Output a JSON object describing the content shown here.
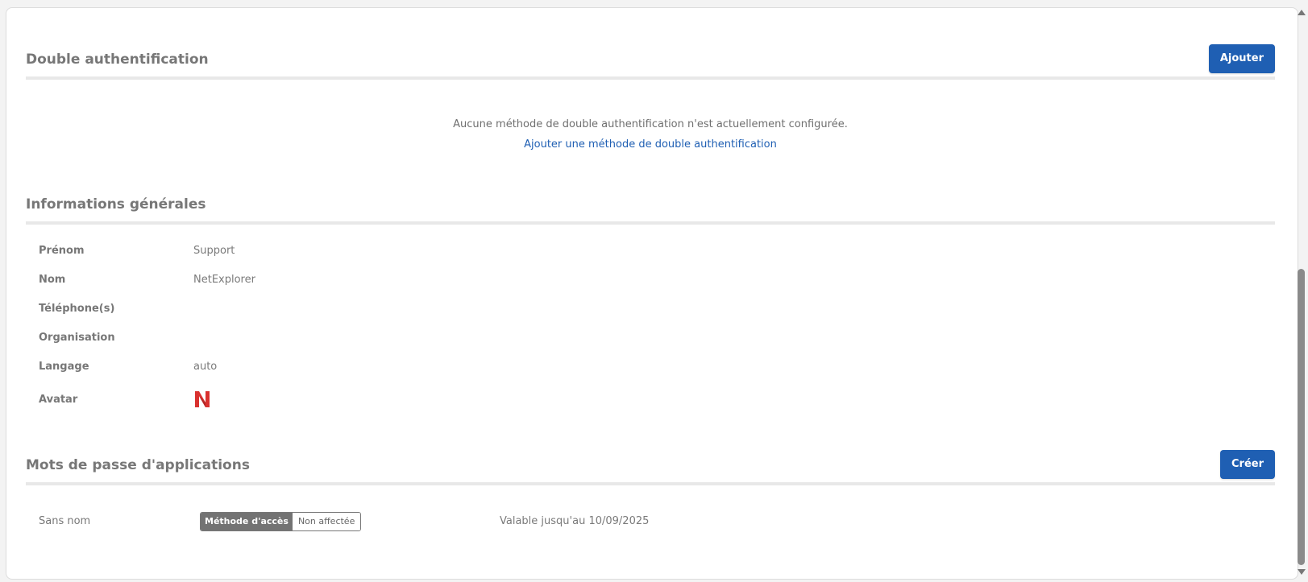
{
  "two_factor": {
    "title": "Double authentification",
    "add_button": "Ajouter",
    "empty_message": "Aucune méthode de double authentification n'est actuellement configurée.",
    "add_link": "Ajouter une méthode de double authentification"
  },
  "general_info": {
    "title": "Informations générales",
    "rows": [
      {
        "label": "Prénom",
        "value": "Support"
      },
      {
        "label": "Nom",
        "value": "NetExplorer"
      },
      {
        "label": "Téléphone(s)",
        "value": ""
      },
      {
        "label": "Organisation",
        "value": ""
      },
      {
        "label": "Langage",
        "value": "auto"
      },
      {
        "label": "Avatar",
        "value": ""
      }
    ],
    "avatar_icon": "netexplorer-logo-icon",
    "avatar_color": "#d9312f"
  },
  "app_passwords": {
    "title": "Mots de passe d'applications",
    "create_button": "Créer",
    "items": [
      {
        "name": "Sans nom",
        "badge_key": "Méthode d'accès",
        "badge_value": "Non affectée",
        "validity": "Valable jusqu'au 10/09/2025"
      }
    ]
  },
  "colors": {
    "primary": "#1f5fb3",
    "badge_dark": "#737373"
  }
}
